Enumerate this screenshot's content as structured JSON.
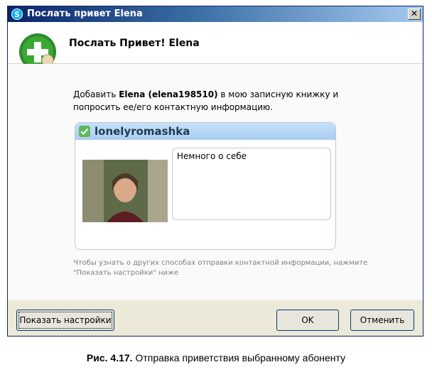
{
  "window": {
    "title": "Послать привет Elena",
    "close_symbol": "✕",
    "app_icon": "skype-icon"
  },
  "header": {
    "title": "Послать Привет! Elena",
    "icon": "add-contact-icon"
  },
  "intro": {
    "prefix": "Добавить ",
    "contact": "Elena (elena198510)",
    "suffix": " в мою записную книжку и попросить ее/его контактную информацию."
  },
  "card": {
    "username": "lonelyromashka",
    "status_icon": "online-status-icon",
    "about_text": "Немного о себе"
  },
  "hint": "Чтобы узнать о других способах отправки контактной информации, нажмите \"Показать настройки\" ниже",
  "buttons": {
    "options_label": "Показать настройки",
    "ok_label": "OK",
    "cancel_label": "Отменить"
  },
  "caption": {
    "figure": "Рис. 4.17.",
    "text": " Отправка приветствия выбранному абоненту"
  },
  "colors": {
    "title_bar": "#0a246a",
    "card_header": "#a8cdf0",
    "accent_green": "#3aa934"
  }
}
